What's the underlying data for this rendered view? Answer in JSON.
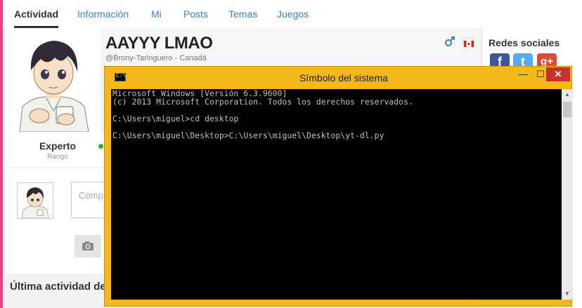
{
  "tabs": [
    "Actividad",
    "Información",
    "Mi",
    "Posts",
    "Temas",
    "Juegos"
  ],
  "profile": {
    "name": "AAYYY LMAO",
    "handle": "@Brony-Taringuero - Canadá",
    "rank": "Experto",
    "rank_label": "Rango",
    "status_color": "#2db32d"
  },
  "compose": {
    "placeholder": "Comp"
  },
  "activity": {
    "title": "Última actividad de"
  },
  "social": {
    "title": "Redes sociales",
    "networks": [
      {
        "name": "facebook",
        "glyph": "f",
        "color": "#3b5998"
      },
      {
        "name": "twitter",
        "glyph": "t",
        "color": "#55acee"
      },
      {
        "name": "google-plus",
        "glyph": "g+",
        "color": "#dd4b39"
      }
    ]
  },
  "cmd": {
    "title": "Símbolo del sistema",
    "icon_text": "C:\\",
    "buttons": {
      "minimize": "—",
      "maximize": "☐",
      "close": "✕"
    },
    "lines": [
      "Microsoft Windows [Versión 6.3.9600]",
      "(c) 2013 Microsoft Corporation. Todos los derechos reservados.",
      "",
      "C:\\Users\\miguel>cd desktop",
      "",
      "C:\\Users\\miguel\\Desktop>C:\\Users\\miguel\\Desktop\\yt-dl.py"
    ]
  },
  "colors": {
    "accent_link": "#3b80c8",
    "cmd_frame": "#f4b818",
    "pink_edge": "#e6408a"
  }
}
